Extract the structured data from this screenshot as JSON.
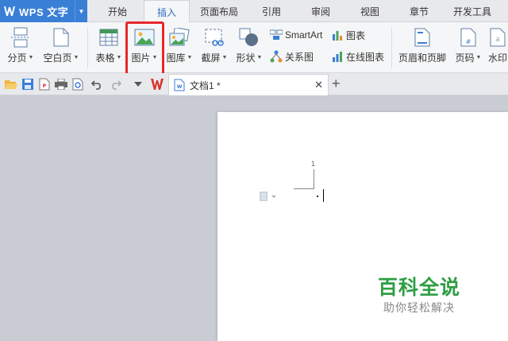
{
  "app": {
    "name": "WPS 文字"
  },
  "menu_tabs": [
    "开始",
    "插入",
    "页面布局",
    "引用",
    "审阅",
    "视图",
    "章节",
    "开发工具"
  ],
  "active_tab": "插入",
  "ribbon": {
    "page_break": "分页",
    "blank_page": "空白页",
    "table": "表格",
    "picture": "图片",
    "gallery": "图库",
    "screenshot": "截屏",
    "shapes": "形状",
    "smartart": "SmartArt",
    "chart": "图表",
    "relation": "关系图",
    "online_chart": "在线图表",
    "header_footer": "页眉和页脚",
    "page_number": "页码",
    "watermark": "水印"
  },
  "document": {
    "tab_title": "文档1 *",
    "page_number": "1"
  },
  "watermark_text": {
    "title": "百科全说",
    "subtitle": "助你轻松解决"
  },
  "colors": {
    "accent": "#3a7fd6",
    "highlight": "#e8282b",
    "watermark": "#2e9e43"
  }
}
